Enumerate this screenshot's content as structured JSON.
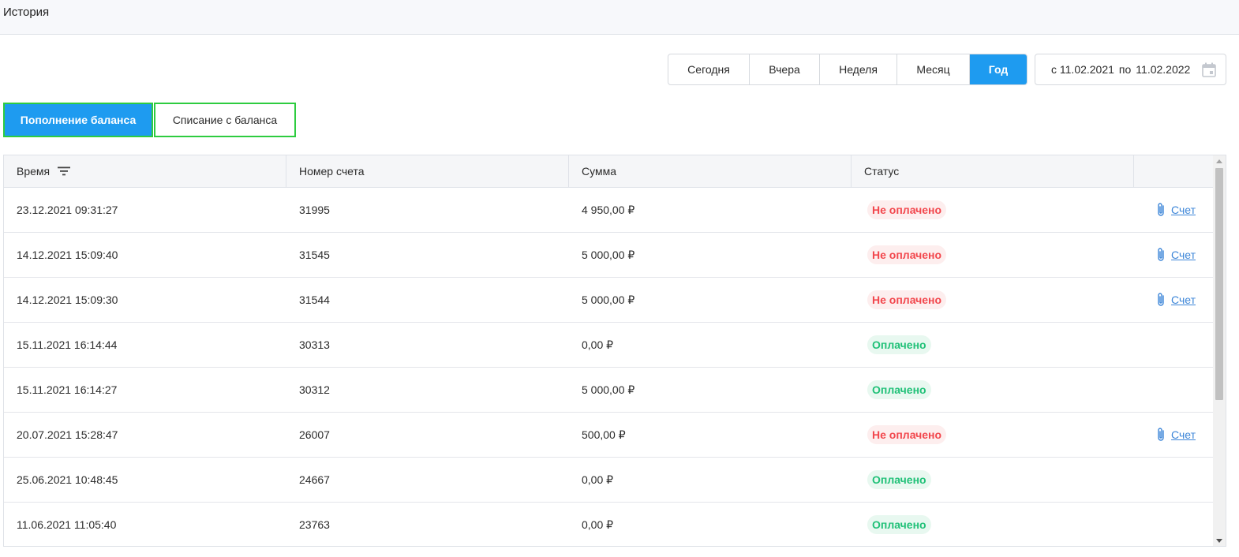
{
  "header": {
    "title": "История"
  },
  "periods": [
    {
      "label": "Сегодня",
      "active": false
    },
    {
      "label": "Вчера",
      "active": false
    },
    {
      "label": "Неделя",
      "active": false
    },
    {
      "label": "Месяц",
      "active": false
    },
    {
      "label": "Год",
      "active": true
    }
  ],
  "date_range": {
    "from_prefix": "с",
    "from": "11.02.2021",
    "to_prefix": "по",
    "to": "11.02.2022",
    "icon": "calendar-icon"
  },
  "tabs": {
    "topup": "Пополнение баланса",
    "debit": "Списание с баланса"
  },
  "table": {
    "columns": [
      "Время",
      "Номер счета",
      "Сумма",
      "Статус",
      ""
    ],
    "rows": [
      {
        "time": "23.12.2021 09:31:27",
        "account": "31995",
        "amount": "4 950,00 ₽",
        "status": "Не оплачено",
        "paid": false,
        "invoice": "Счет"
      },
      {
        "time": "14.12.2021 15:09:40",
        "account": "31545",
        "amount": "5 000,00 ₽",
        "status": "Не оплачено",
        "paid": false,
        "invoice": "Счет"
      },
      {
        "time": "14.12.2021 15:09:30",
        "account": "31544",
        "amount": "5 000,00 ₽",
        "status": "Не оплачено",
        "paid": false,
        "invoice": "Счет"
      },
      {
        "time": "15.11.2021 16:14:44",
        "account": "30313",
        "amount": "0,00 ₽",
        "status": "Оплачено",
        "paid": true,
        "invoice": ""
      },
      {
        "time": "15.11.2021 16:14:27",
        "account": "30312",
        "amount": "5 000,00 ₽",
        "status": "Оплачено",
        "paid": true,
        "invoice": ""
      },
      {
        "time": "20.07.2021 15:28:47",
        "account": "26007",
        "amount": "500,00 ₽",
        "status": "Не оплачено",
        "paid": false,
        "invoice": "Счет"
      },
      {
        "time": "25.06.2021 10:48:45",
        "account": "24667",
        "amount": "0,00 ₽",
        "status": "Оплачено",
        "paid": true,
        "invoice": ""
      },
      {
        "time": "11.06.2021 11:05:40",
        "account": "23763",
        "amount": "0,00 ₽",
        "status": "Оплачено",
        "paid": true,
        "invoice": ""
      }
    ]
  },
  "colors": {
    "accent": "#1e9bf0",
    "tab_outline": "#2ecc40",
    "unpaid": "#f2474d",
    "paid": "#21c178",
    "link": "#3d86d8"
  }
}
